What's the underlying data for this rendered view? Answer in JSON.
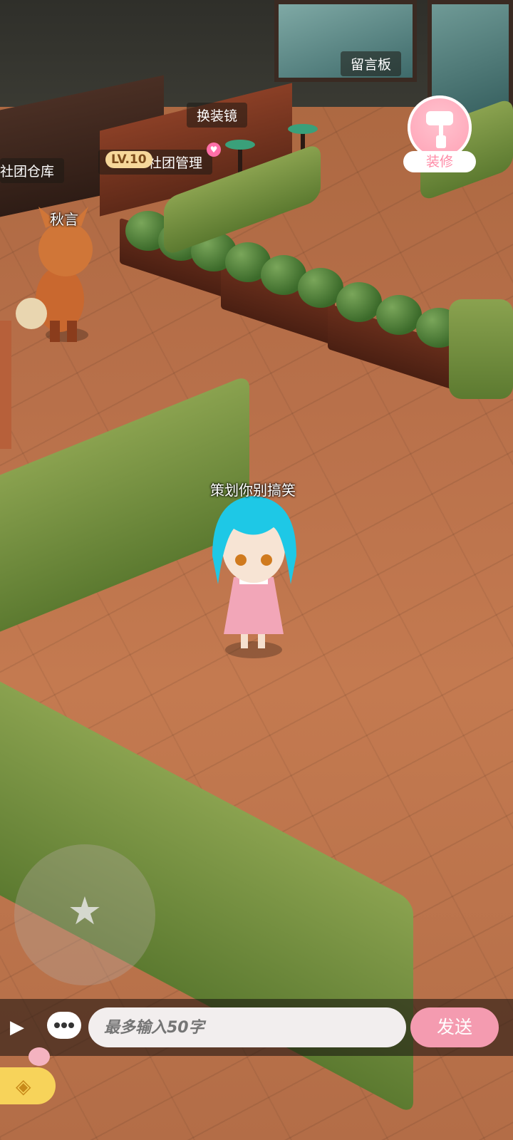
{
  "map_labels": {
    "guestbook": "留言板",
    "mirror": "换装镜",
    "club_manage": "社团管理",
    "club_level": "LV.10",
    "warehouse": "社团仓库"
  },
  "players": {
    "other": "秋言",
    "self": "策划你别搞笑"
  },
  "decor": {
    "label": "装修",
    "icon": "paint-roller-icon"
  },
  "joystick": {
    "icon": "star-icon"
  },
  "chat": {
    "placeholder": "最多输入50字",
    "send_label": "发送",
    "icon": "chat-bubble-icon"
  },
  "colors": {
    "accent_pink": "#f49bb0",
    "level_badge": "#f6d79a",
    "hair_cyan": "#1ec8e6"
  }
}
